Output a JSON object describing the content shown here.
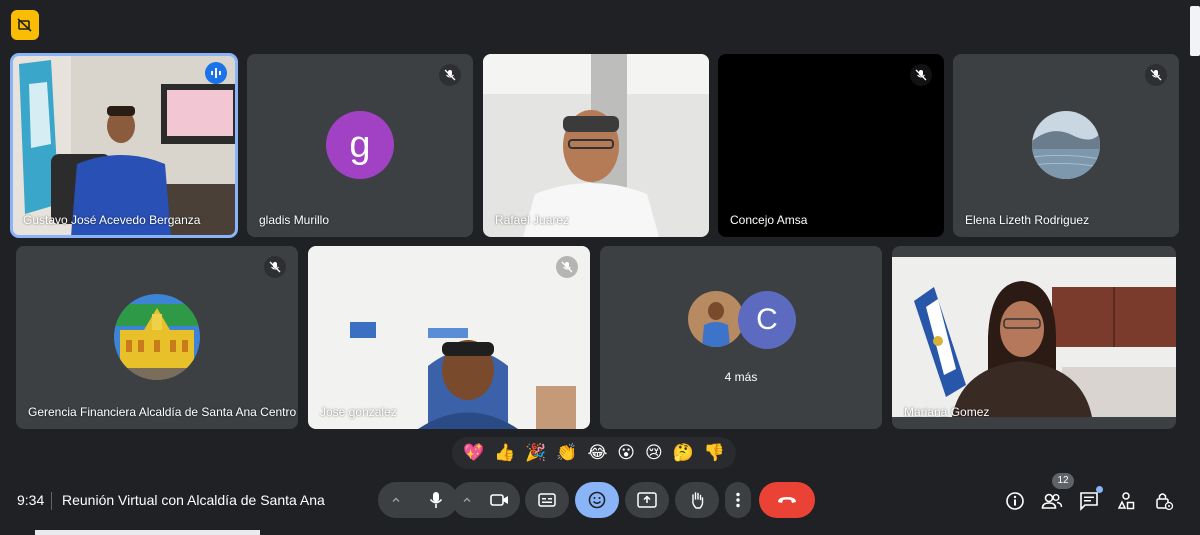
{
  "meeting": {
    "time": "9:34",
    "title": "Reunión Virtual con Alcaldía de Santa Ana"
  },
  "participants": [
    {
      "name": "Gustavo José Acevedo Berganza"
    },
    {
      "name": "gladis Murillo",
      "avatar_letter": "g",
      "avatar_color": "#a142c4"
    },
    {
      "name": "Rafael Juarez"
    },
    {
      "name": "Concejo Amsa"
    },
    {
      "name": "Elena Lizeth Rodriguez"
    },
    {
      "name": "Gerencia Financiera Alcaldía de Santa Ana Centro"
    },
    {
      "name": "Jose gonzalez"
    },
    {
      "name": "Mariana Gomez"
    }
  ],
  "more_tile": {
    "label": "4 más",
    "avatar_letter": "C",
    "avatar_color": "#5c6bc0"
  },
  "reactions": [
    "💖",
    "👍",
    "🎉",
    "👏",
    "😂",
    "😮",
    "😢",
    "🤔",
    "👎"
  ],
  "people_count": "12",
  "colors": {
    "background": "#202124",
    "tile": "#3c4043",
    "accent_blue": "#8ab4f8",
    "end_call": "#ea4335",
    "badge": "#fbbc04"
  },
  "icons": {
    "top_badge": "hidden-self-view-icon",
    "mic": "mic-icon",
    "camera": "camera-icon",
    "captions": "closed-captions-icon",
    "emoji": "emoji-icon",
    "present": "present-screen-icon",
    "hand": "raise-hand-icon",
    "more": "more-options-icon",
    "end": "end-call-icon",
    "info": "info-icon",
    "people": "people-icon",
    "chat": "chat-icon",
    "activities": "activities-icon",
    "host": "host-controls-icon"
  }
}
